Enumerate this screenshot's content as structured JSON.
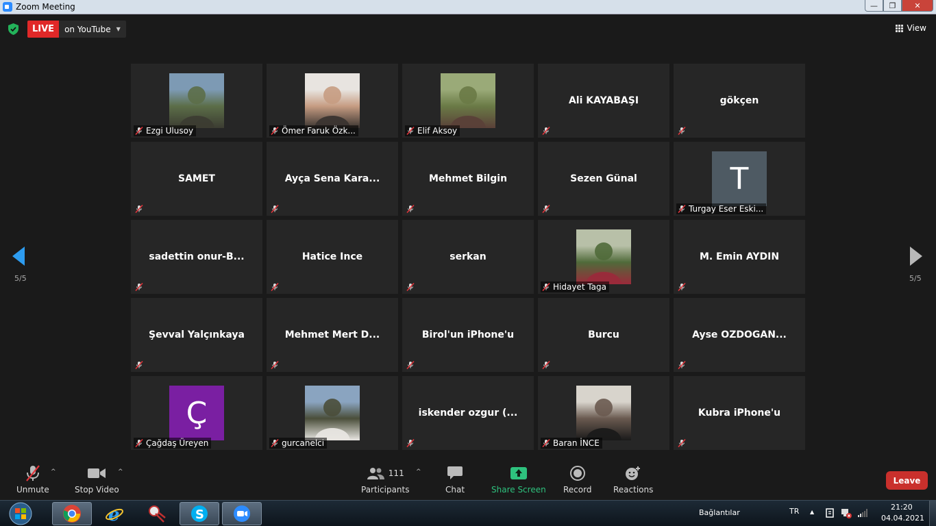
{
  "window": {
    "title": "Zoom Meeting",
    "min": "—",
    "max": "❐",
    "close": "✕"
  },
  "topbar": {
    "live_badge": "LIVE",
    "live_target": "on YouTube",
    "live_caret": "▼",
    "view_label": "View"
  },
  "pagination": {
    "left": "5/5",
    "right": "5/5"
  },
  "participants": [
    {
      "name": "Ezgi Ulusoy",
      "type": "photo",
      "photo_colors": [
        "#7d9ab4",
        "#5c6e48",
        "#3c3c32"
      ]
    },
    {
      "name": "Ömer Faruk Özk...",
      "type": "photo",
      "photo_colors": [
        "#e8e4e0",
        "#c69c82",
        "#3a3430"
      ]
    },
    {
      "name": "Elif Aksoy",
      "type": "photo",
      "photo_colors": [
        "#9aaa78",
        "#6a7a46",
        "#5a4038"
      ]
    },
    {
      "name": "Ali KAYABAŞI",
      "type": "text"
    },
    {
      "name": "gökçen",
      "type": "text"
    },
    {
      "name": "SAMET",
      "type": "text"
    },
    {
      "name": "Ayça  Sena  Kara...",
      "type": "text"
    },
    {
      "name": "Mehmet Bilgin",
      "type": "text"
    },
    {
      "name": "Sezen Günal",
      "type": "text"
    },
    {
      "name": "Turgay Eser Eski...",
      "type": "letter",
      "letter": "T",
      "avatar_color": "#4e5a63"
    },
    {
      "name": "sadettin  onur-B...",
      "type": "text"
    },
    {
      "name": "Hatice Ince",
      "type": "text"
    },
    {
      "name": "serkan",
      "type": "text"
    },
    {
      "name": "Hidayet Taga",
      "type": "photo",
      "photo_colors": [
        "#b8c0a8",
        "#506a3a",
        "#9a2a3a"
      ]
    },
    {
      "name": "M. Emin AYDIN",
      "type": "text"
    },
    {
      "name": "Şevval Yalçınkaya",
      "type": "text"
    },
    {
      "name": "Mehmet  Mert  D...",
      "type": "text"
    },
    {
      "name": "Birol'un iPhone'u",
      "type": "text"
    },
    {
      "name": "Burcu",
      "type": "text"
    },
    {
      "name": "Ayse  OZDOGAN...",
      "type": "text"
    },
    {
      "name": "Çağdaş Üreyen",
      "type": "letter",
      "letter": "Ç",
      "avatar_color": "#7a1fa2"
    },
    {
      "name": "gurcanelci",
      "type": "photo",
      "photo_colors": [
        "#8aa4c0",
        "#4a4e3a",
        "#e8e6e2"
      ]
    },
    {
      "name": "iskender  ozgur  (...",
      "type": "text"
    },
    {
      "name": "Baran İNCE",
      "type": "photo",
      "photo_colors": [
        "#d8d4cc",
        "#6a5a50",
        "#1a1a1a"
      ]
    },
    {
      "name": "Kubra iPhone'u",
      "type": "text"
    }
  ],
  "toolbar": {
    "unmute": "Unmute",
    "stop_video": "Stop Video",
    "participants": "Participants",
    "participant_count": "111",
    "chat": "Chat",
    "share_screen": "Share Screen",
    "record": "Record",
    "reactions": "Reactions",
    "leave": "Leave",
    "caret": "^"
  },
  "taskbar": {
    "links_label": "Bağlantılar",
    "language": "TR",
    "time": "21:20",
    "date": "04.04.2021",
    "tray_arrow": "▲"
  },
  "colors": {
    "accent_blue": "#2d8cff",
    "live_red": "#e02828",
    "share_green": "#2ec27e",
    "leave_red": "#c9302c",
    "nav_arrow": "#2d9cf0"
  }
}
